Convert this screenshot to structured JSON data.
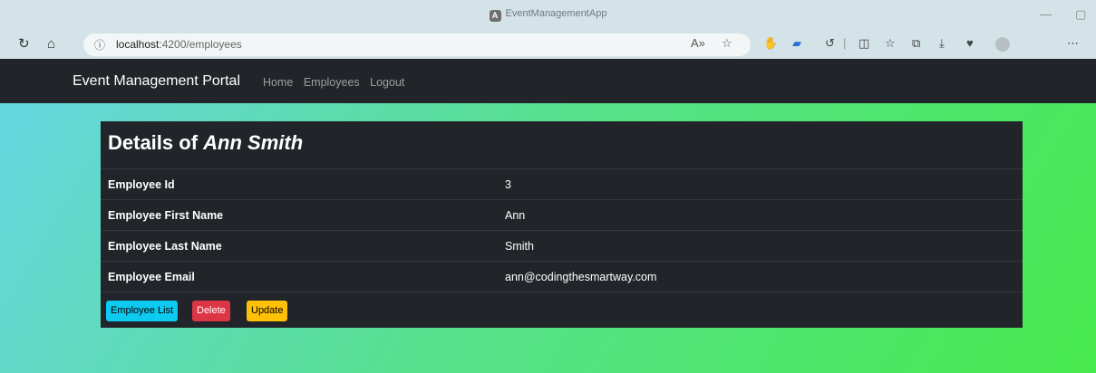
{
  "browser": {
    "tab_title": "EventManagementApp",
    "url_host": "localhost",
    "url_path": ":4200/employees"
  },
  "navbar": {
    "brand": "Event Management Portal",
    "links": [
      "Home",
      "Employees",
      "Logout"
    ]
  },
  "details": {
    "heading_prefix": "Details of",
    "heading_name": "Ann Smith",
    "rows": [
      {
        "label": "Employee Id",
        "value": "3"
      },
      {
        "label": "Employee First Name",
        "value": "Ann"
      },
      {
        "label": "Employee Last Name",
        "value": "Smith"
      },
      {
        "label": "Employee Email",
        "value": "ann@codingthesmartway.com"
      }
    ]
  },
  "buttons": {
    "list": "Employee List",
    "delete": "Delete",
    "update": "Update"
  },
  "colors": {
    "navbar_bg": "#212529",
    "info": "#0dcaf0",
    "danger": "#dc3545",
    "warning": "#ffc107"
  }
}
